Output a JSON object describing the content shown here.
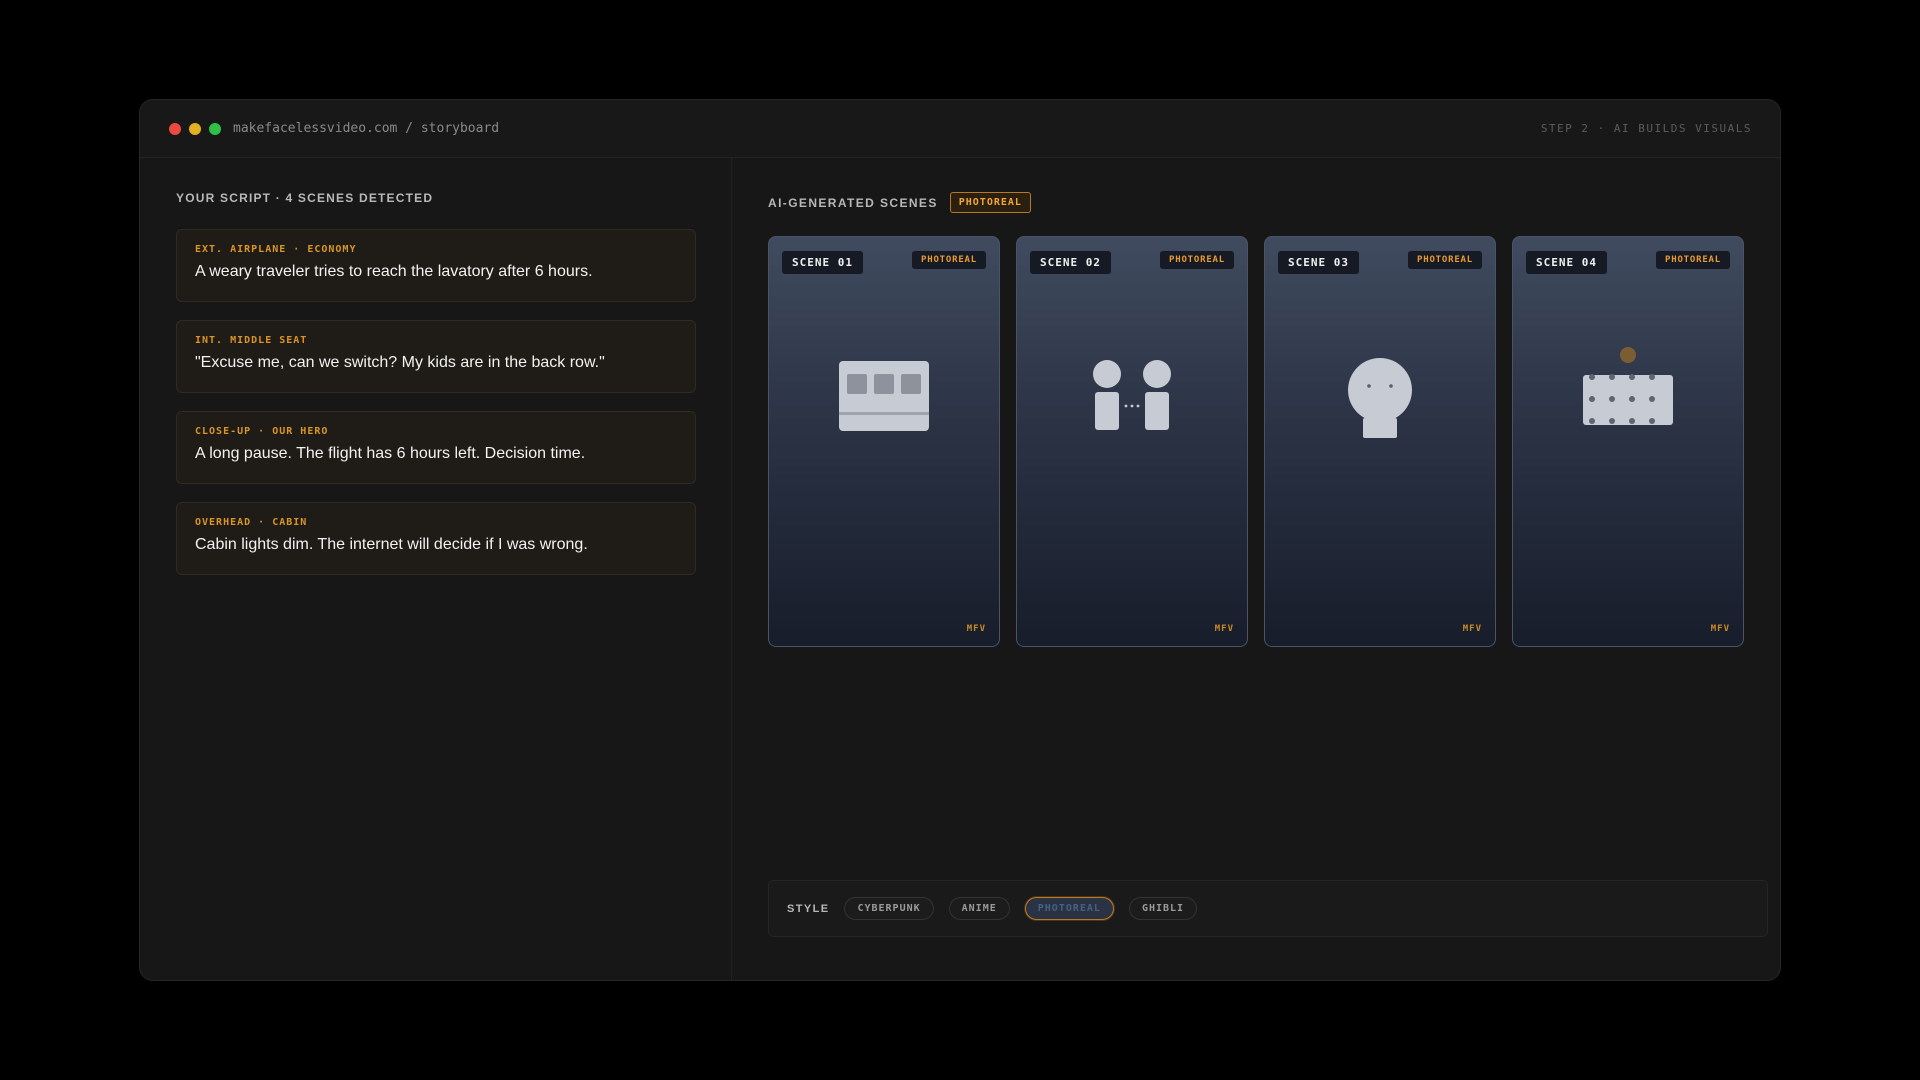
{
  "window": {
    "url": "makefacelessvideo.com / storyboard",
    "step": "STEP 2 · AI BUILDS VISUALS"
  },
  "script_panel": {
    "title": "YOUR SCRIPT · 4 SCENES DETECTED",
    "items": [
      {
        "tag": "EXT. AIRPLANE · ECONOMY",
        "text": "A weary traveler tries to reach the lavatory after 6 hours."
      },
      {
        "tag": "INT. MIDDLE SEAT",
        "text": "\"Excuse me, can we switch? My kids are in the back row.\""
      },
      {
        "tag": "CLOSE-UP · OUR HERO",
        "text": "A long pause. The flight has 6 hours left. Decision time."
      },
      {
        "tag": "OVERHEAD · CABIN",
        "text": "Cabin lights dim. The internet will decide if I was wrong."
      }
    ]
  },
  "scenes_panel": {
    "title": "AI-GENERATED SCENES",
    "badge": "PHOTOREAL",
    "cards": [
      {
        "label": "SCENE 01",
        "style": "PHOTOREAL",
        "mark": "MFV",
        "icon": "airplane-seats-icon"
      },
      {
        "label": "SCENE 02",
        "style": "PHOTOREAL",
        "mark": "MFV",
        "icon": "two-people-talking-icon"
      },
      {
        "label": "SCENE 03",
        "style": "PHOTOREAL",
        "mark": "MFV",
        "icon": "face-closeup-icon"
      },
      {
        "label": "SCENE 04",
        "style": "PHOTOREAL",
        "mark": "MFV",
        "icon": "cabin-overhead-icon"
      }
    ]
  },
  "style_bar": {
    "label": "STYLE",
    "options": [
      "CYBERPUNK",
      "ANIME",
      "PHOTOREAL",
      "GHIBLI"
    ],
    "selected": "PHOTOREAL"
  },
  "colors": {
    "accent": "#d99526",
    "background": "#171717",
    "card_gradient_top": "#404b5f",
    "card_gradient_bottom": "#171d2a"
  }
}
